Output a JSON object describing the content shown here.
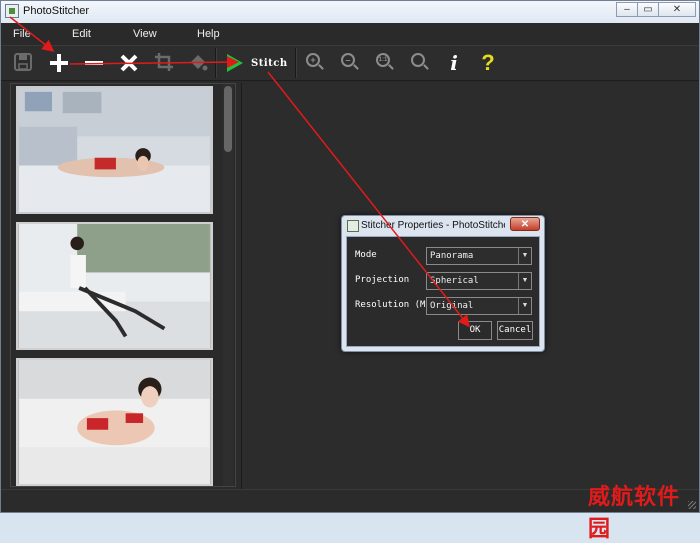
{
  "window": {
    "title": "PhotoStitcher",
    "controls": [
      "–",
      "▭",
      "✕"
    ]
  },
  "menu": [
    "File",
    "Edit",
    "View",
    "Help"
  ],
  "toolbar": {
    "icons": [
      "save-icon",
      "add-icon",
      "remove-icon",
      "clear-icon",
      "crop-icon",
      "fill-icon"
    ],
    "stitch_label": "Stitch",
    "zoom_icons": [
      "zoom-in-icon",
      "zoom-out-icon",
      "zoom-1to1-icon",
      "zoom-fit-icon"
    ],
    "info_glyph": "i",
    "help_glyph": "?"
  },
  "zoom_1to1_text": "1:1",
  "dialog": {
    "title": "Stitcher Properties - PhotoStitcher",
    "close": "✕",
    "rows": [
      {
        "label": "Mode",
        "value": "Panorama"
      },
      {
        "label": "Projection",
        "value": "Spherical"
      },
      {
        "label": "Resolution (MP)",
        "value": "Original"
      }
    ],
    "ok": "OK",
    "cancel": "Cancel"
  },
  "watermark": "威航软件园",
  "colors": {
    "accent_green": "#1ec23b",
    "help_yellow": "#e6db1d",
    "arrow_red": "#e01b1b"
  }
}
